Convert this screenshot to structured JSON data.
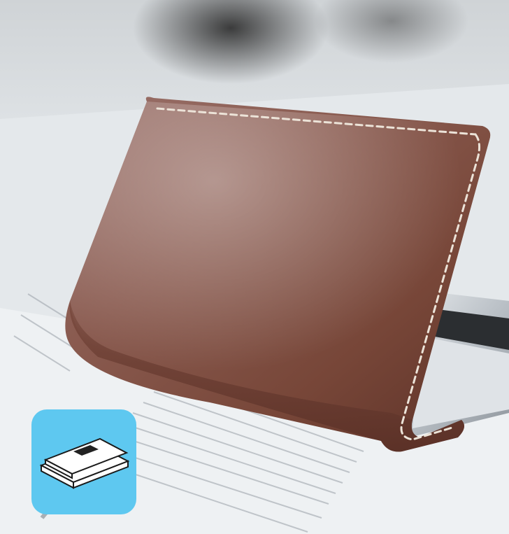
{
  "photo": {
    "subject": "brown-leather-business-card-holder",
    "elements": [
      "blurred-background",
      "newspaper",
      "leather-card-case",
      "metal-card-tray",
      "stitching"
    ],
    "colors": {
      "leather": "#7a4a40",
      "leather_dark": "#4e2a24",
      "stitching": "#e8ddd2",
      "paper": "#eef1f3",
      "background": "#d9dde0",
      "metal": "#c9ced3"
    }
  },
  "badge": {
    "icon": "card-holder-icon",
    "background": "#5ec8f0",
    "icon_color": "#ffffff",
    "slot_color": "#222222"
  }
}
